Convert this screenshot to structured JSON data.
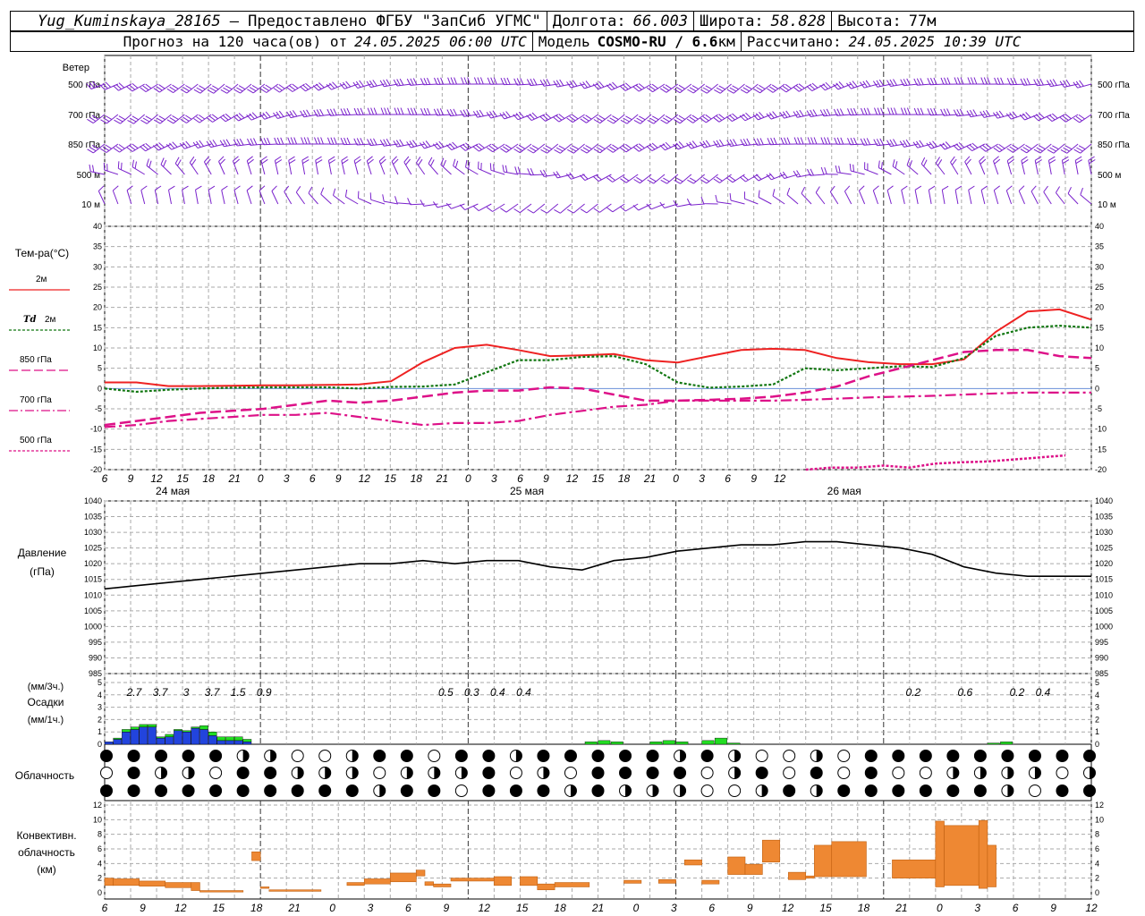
{
  "header": {
    "station": "Yug_Kuminskaya_28165",
    "provider": "— Предоставлено ФГБУ \"ЗапСиб УГМС\"",
    "lon_label": "Долгота:",
    "lon_value": "66.003",
    "lat_label": "Широта:",
    "lat_value": "58.828",
    "alt_label": "Высота:",
    "alt_value": "77м",
    "forecast_text": "Прогноз на 120 часа(ов) от",
    "forecast_from": "24.05.2025 06:00 UTC",
    "model_label": "Модель",
    "model_name": "COSMO-RU / 6.6",
    "model_unit": "км",
    "calc_label": "Рассчитано:",
    "calc_value": "24.05.2025 10:39 UTC"
  },
  "colors": {
    "temp": "#ee2222",
    "dew": "#117711",
    "iso": "#dd1188",
    "pressure": "#000000",
    "precip_conv": "#2244dd",
    "precip_strat": "#22dd22",
    "conv_cloud": "#ee8833",
    "wind": "#7a22cc",
    "grid": "#aaaaaa"
  },
  "chart_data": [
    {
      "type": "wind",
      "title": "Ветер",
      "levels": [
        "500 гПа",
        "700 гПа",
        "850 гПа",
        "500 м",
        "10 м"
      ],
      "note": "Ветровые бородки по уровням"
    },
    {
      "type": "line",
      "ylabel": "Тем-ра(°С)",
      "ylim": [
        -20,
        40
      ],
      "yticks": [
        40,
        35,
        30,
        25,
        20,
        15,
        10,
        5,
        0,
        -5,
        -10,
        -15,
        -20
      ],
      "legend": [
        {
          "label": "2м",
          "italic": "",
          "style": "solid",
          "color": "#ee2222"
        },
        {
          "label": "2м",
          "italic": "Td",
          "style": "dot",
          "color": "#117711"
        },
        {
          "label": "850 гПа",
          "italic": "",
          "style": "dash",
          "color": "#dd1188"
        },
        {
          "label": "700 гПа",
          "italic": "",
          "style": "dashdot",
          "color": "#dd1188"
        },
        {
          "label": "500 гПа",
          "italic": "",
          "style": "dot",
          "color": "#dd1188"
        }
      ],
      "x_hours": [
        0,
        3,
        6,
        9,
        12,
        15,
        18,
        21,
        24,
        27,
        30,
        33,
        36,
        39,
        42,
        45,
        48,
        51,
        54,
        57,
        60,
        63,
        66,
        69,
        72,
        75,
        78,
        81,
        84,
        87,
        90,
        93,
        96,
        99,
        102,
        105,
        108,
        111,
        114
      ],
      "series": [
        {
          "key": "t2m",
          "values": [
            1.5,
            1.5,
            0.6,
            0.6,
            0.7,
            0.8,
            0.8,
            0.9,
            1.0,
            1.8,
            6.5,
            10.0,
            10.8,
            9.5,
            8.0,
            8.2,
            8.5,
            7.0,
            6.4,
            8.0,
            9.5,
            9.8,
            9.5,
            7.5,
            6.5,
            6.0,
            6.0,
            7.2,
            14.0,
            19.0,
            19.5,
            17.0
          ]
        },
        {
          "key": "td2m",
          "values": [
            0,
            -0.8,
            -0.3,
            0.0,
            0.2,
            0.3,
            0.3,
            0.3,
            0.0,
            0.4,
            0.5,
            1.0,
            4.0,
            7.0,
            7.0,
            7.8,
            8.0,
            6.0,
            1.5,
            0.2,
            0.5,
            1.0,
            5.0,
            4.5,
            5.0,
            5.5,
            5.3,
            7.5,
            13.0,
            15.0,
            15.5,
            15.0
          ]
        },
        {
          "key": "t850",
          "values": [
            -9.0,
            -8.0,
            -7.0,
            -6.0,
            -5.5,
            -5.0,
            -4.0,
            -3.0,
            -3.5,
            -3.0,
            -2.0,
            -1.0,
            -0.5,
            -0.5,
            0.3,
            0.0,
            -1.5,
            -3.0,
            -3.0,
            -2.8,
            -2.5,
            -2.0,
            -1.0,
            0.5,
            3.0,
            5.0,
            7.0,
            9.0,
            9.5,
            9.5,
            8.0,
            7.5
          ]
        },
        {
          "key": "t700",
          "values": [
            -9.5,
            -9.0,
            -8.0,
            -7.5,
            -7.0,
            -6.5,
            -6.5,
            -6.0,
            -7.0,
            -8.0,
            -9.0,
            -8.5,
            -8.5,
            -8.0,
            -6.5,
            -5.5,
            -4.5,
            -4.0,
            -3.0,
            -3.0,
            -3.0,
            -3.0,
            -2.8,
            -2.5,
            -2.2,
            -2.0,
            -1.8,
            -1.5,
            -1.2,
            -1.0,
            -1.0,
            -1.0
          ]
        },
        {
          "key": "t500",
          "start_hour": 81,
          "values": [
            -20.0,
            -19.5,
            -19.5,
            -19.0,
            -19.5,
            -18.5,
            -18.2,
            -18.0,
            -17.5,
            -17.0,
            -16.5
          ]
        }
      ]
    },
    {
      "type": "line",
      "ylabel": "Давление",
      "yunit": "(гПа)",
      "ylim": [
        985,
        1040
      ],
      "yticks": [
        1040,
        1035,
        1030,
        1025,
        1020,
        1015,
        1010,
        1005,
        1000,
        995,
        990,
        985
      ],
      "values": [
        1012,
        1013,
        1014,
        1015,
        1016,
        1017,
        1018,
        1019,
        1020,
        1020,
        1021,
        1020,
        1021,
        1021,
        1019,
        1018,
        1021,
        1022,
        1024,
        1025,
        1026,
        1026,
        1027,
        1027,
        1026,
        1025,
        1023,
        1019,
        1017,
        1016,
        1016,
        1016
      ]
    },
    {
      "type": "bar",
      "ylabel": "Осадки",
      "yunit_top": "(мм/3ч.)",
      "yunit_bottom": "(мм/1ч.)",
      "ylim": [
        0,
        5
      ],
      "yticks": [
        5,
        4,
        3,
        2,
        1,
        0
      ],
      "three_hour_totals": [
        {
          "hour": 3,
          "label": "2.7"
        },
        {
          "hour": 6,
          "label": "3.7"
        },
        {
          "hour": 9,
          "label": "3"
        },
        {
          "hour": 12,
          "label": "3.7"
        },
        {
          "hour": 15,
          "label": "1.5"
        },
        {
          "hour": 18,
          "label": "0.9"
        },
        {
          "hour": 39,
          "label": "0.5"
        },
        {
          "hour": 42,
          "label": "0.3"
        },
        {
          "hour": 45,
          "label": "0.4"
        },
        {
          "hour": 48,
          "label": "0.4"
        },
        {
          "hour": 93,
          "label": "0.2"
        },
        {
          "hour": 99,
          "label": "0.6"
        },
        {
          "hour": 105,
          "label": "0.2"
        },
        {
          "hour": 108,
          "label": "0.4"
        }
      ],
      "hourly_conv": [
        0.2,
        0.4,
        1.0,
        1.2,
        1.4,
        1.4,
        0.5,
        0.6,
        1.1,
        1.0,
        1.3,
        1.2,
        0.7,
        0.3,
        0.3,
        0.3,
        0.2
      ],
      "hourly_strat": [
        0.0,
        0.1,
        0.2,
        0.2,
        0.2,
        0.2,
        0.1,
        0.2,
        0.1,
        0.1,
        0.1,
        0.3,
        0.3,
        0.3,
        0.3,
        0.3,
        0.2
      ]
    },
    {
      "type": "table",
      "ylabel": "Облачность",
      "rows": 3,
      "cols": 37,
      "note": "Кружки облачности (верхний, средний, нижний ярусы)"
    },
    {
      "type": "bar",
      "ylabel": "Конвективн. облачность",
      "yunit": "(км)",
      "ylim": [
        0,
        12
      ],
      "yticks": [
        12,
        10,
        8,
        6,
        4,
        2,
        0
      ],
      "segments": [
        {
          "h0": 0,
          "h1": 1,
          "base": 1.0,
          "top": 2.0
        },
        {
          "h0": 1,
          "h1": 4,
          "base": 1.0,
          "top": 1.9
        },
        {
          "h0": 4,
          "h1": 7,
          "base": 0.9,
          "top": 1.6
        },
        {
          "h0": 7,
          "h1": 10,
          "base": 0.7,
          "top": 1.4
        },
        {
          "h0": 10,
          "h1": 11,
          "base": 0.3,
          "top": 1.4
        },
        {
          "h0": 11,
          "h1": 16,
          "base": 0.1,
          "top": 0.3
        },
        {
          "h0": 17,
          "h1": 18,
          "base": 4.4,
          "top": 5.6
        },
        {
          "h0": 18,
          "h1": 19,
          "base": 0.6,
          "top": 0.8
        },
        {
          "h0": 19,
          "h1": 25,
          "base": 0.2,
          "top": 0.4
        },
        {
          "h0": 28,
          "h1": 30,
          "base": 1.0,
          "top": 1.4
        },
        {
          "h0": 30,
          "h1": 33,
          "base": 1.2,
          "top": 1.9
        },
        {
          "h0": 33,
          "h1": 36,
          "base": 1.5,
          "top": 2.7
        },
        {
          "h0": 36,
          "h1": 37,
          "base": 2.3,
          "top": 3.1
        },
        {
          "h0": 37,
          "h1": 38,
          "base": 1.0,
          "top": 1.5
        },
        {
          "h0": 38,
          "h1": 40,
          "base": 0.8,
          "top": 1.2
        },
        {
          "h0": 40,
          "h1": 45,
          "base": 1.6,
          "top": 2.0
        },
        {
          "h0": 45,
          "h1": 47,
          "base": 1.0,
          "top": 2.2
        },
        {
          "h0": 48,
          "h1": 50,
          "base": 1.0,
          "top": 2.2
        },
        {
          "h0": 50,
          "h1": 52,
          "base": 0.4,
          "top": 1.2
        },
        {
          "h0": 52,
          "h1": 56,
          "base": 0.8,
          "top": 1.4
        },
        {
          "h0": 60,
          "h1": 62,
          "base": 1.3,
          "top": 1.7
        },
        {
          "h0": 64,
          "h1": 66,
          "base": 1.3,
          "top": 1.8
        },
        {
          "h0": 67,
          "h1": 69,
          "base": 3.8,
          "top": 4.5
        },
        {
          "h0": 69,
          "h1": 71,
          "base": 1.2,
          "top": 1.7
        },
        {
          "h0": 72,
          "h1": 74,
          "base": 2.5,
          "top": 4.9
        },
        {
          "h0": 74,
          "h1": 76,
          "base": 2.5,
          "top": 3.9
        },
        {
          "h0": 76,
          "h1": 78,
          "base": 4.2,
          "top": 7.2
        },
        {
          "h0": 79,
          "h1": 81,
          "base": 1.8,
          "top": 2.8
        },
        {
          "h0": 81,
          "h1": 82,
          "base": 2.0,
          "top": 2.3
        },
        {
          "h0": 82,
          "h1": 84,
          "base": 2.2,
          "top": 6.5
        },
        {
          "h0": 84,
          "h1": 88,
          "base": 2.2,
          "top": 7.0
        },
        {
          "h0": 91,
          "h1": 96,
          "base": 2.0,
          "top": 4.5
        },
        {
          "h0": 96,
          "h1": 97,
          "base": 0.8,
          "top": 9.8
        },
        {
          "h0": 97,
          "h1": 101,
          "base": 1.0,
          "top": 9.2
        },
        {
          "h0": 101,
          "h1": 102,
          "base": 0.6,
          "top": 9.9
        },
        {
          "h0": 102,
          "h1": 103,
          "base": 0.8,
          "top": 6.5
        }
      ]
    }
  ],
  "axis": {
    "hour_labels": [
      "6",
      "9",
      "12",
      "15",
      "18",
      "21",
      "0",
      "3",
      "6",
      "9",
      "12",
      "15",
      "18",
      "21",
      "0",
      "3",
      "6",
      "9",
      "12",
      "15",
      "18",
      "21",
      "0",
      "3",
      "6",
      "9",
      "12"
    ],
    "dates": [
      "24 мая",
      "25 мая",
      "26 мая"
    ]
  }
}
